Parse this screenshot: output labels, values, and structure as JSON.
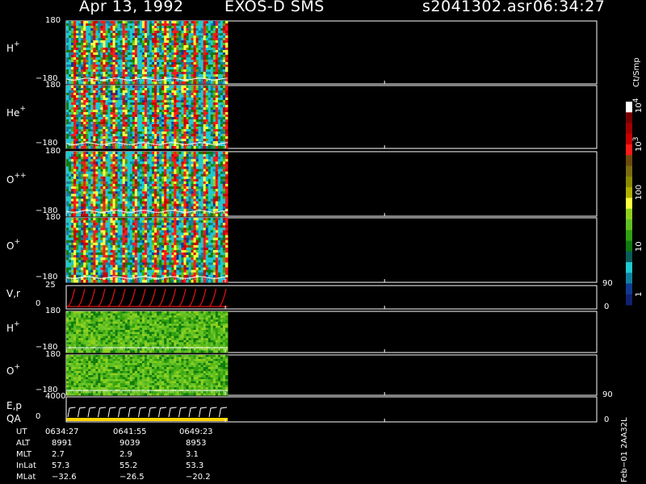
{
  "header": {
    "date": "Apr 13, 1992",
    "instrument": "EXOS-D SMS",
    "file": "s2041302.asr",
    "time": "06:34:27"
  },
  "panels": [
    {
      "name": "H",
      "sup": "+",
      "ymax": "180",
      "ymin": "−180",
      "palette": "spectro"
    },
    {
      "name": "He",
      "sup": "+",
      "ymax": "180",
      "ymin": "−180",
      "palette": "spectro"
    },
    {
      "name": "O",
      "sup": "++",
      "ymax": "180",
      "ymin": "−180",
      "palette": "spectro"
    },
    {
      "name": "O",
      "sup": "+",
      "ymax": "180",
      "ymin": "−180",
      "palette": "spectro"
    },
    {
      "name": "V,r",
      "sup": "",
      "ymax": "25",
      "ymin": "0",
      "right_max": "90",
      "right_min": "0",
      "palette": "line"
    },
    {
      "name": "H",
      "sup": "+",
      "ymax": "180",
      "ymin": "−180",
      "palette": "green"
    },
    {
      "name": "O",
      "sup": "+",
      "ymax": "180",
      "ymin": "−180",
      "palette": "green"
    },
    {
      "name": "E,p",
      "name2": "QA",
      "sup": "",
      "ymax": "4000",
      "ymin": "0",
      "right_max": "90",
      "right_min": "0",
      "palette": "step"
    }
  ],
  "colorbar": {
    "title": "Ct/Smp",
    "labels": [
      "10^4",
      "10^3",
      "100",
      "10",
      "1"
    ],
    "colors": [
      "#ffffff",
      "#7a0000",
      "#a00000",
      "#c80000",
      "#ff1a1a",
      "#6b4a10",
      "#7a6a10",
      "#8a8a00",
      "#b0b000",
      "#ffff40",
      "#90d020",
      "#60c020",
      "#30a010",
      "#107a10",
      "#0a5a5a",
      "#20c8d0",
      "#1080a0",
      "#103a90",
      "#102070"
    ]
  },
  "orbit": {
    "rows": [
      {
        "label": "UT",
        "values": [
          "0634:27",
          "0641:55",
          "0649:23"
        ]
      },
      {
        "label": "ALT",
        "values": [
          "8991",
          "9039",
          "8953"
        ]
      },
      {
        "label": "MLT",
        "values": [
          "2.7",
          "2.9",
          "3.1"
        ]
      },
      {
        "label": "InLat",
        "values": [
          "57.3",
          "55.2",
          "53.3"
        ]
      },
      {
        "label": "MLat",
        "values": [
          "−32.6",
          "−26.5",
          "−20.2"
        ]
      }
    ]
  },
  "footer_code": "Feb−01 2AA32L",
  "chart_data": {
    "type": "heatmap",
    "title": "Apr 13, 1992   EXOS-D SMS",
    "x_ticks": [
      "0634:27",
      "0641:55",
      "0649:23"
    ],
    "data_fraction_of_time_axis": 0.3,
    "cycles_in_data": 16,
    "colorbar_range": [
      1,
      10000
    ],
    "colorbar_scale": "log",
    "series": [
      {
        "name": "H+",
        "ylim": [
          -180,
          180
        ]
      },
      {
        "name": "He+",
        "ylim": [
          -180,
          180
        ]
      },
      {
        "name": "O++",
        "ylim": [
          -180,
          180
        ]
      },
      {
        "name": "O+",
        "ylim": [
          -180,
          180
        ]
      },
      {
        "name": "V,r",
        "ylim": [
          0,
          25
        ]
      },
      {
        "name": "H+",
        "ylim": [
          -180,
          180
        ]
      },
      {
        "name": "O+",
        "ylim": [
          -180,
          180
        ]
      },
      {
        "name": "E,p",
        "ylim": [
          0,
          4000
        ]
      }
    ]
  }
}
